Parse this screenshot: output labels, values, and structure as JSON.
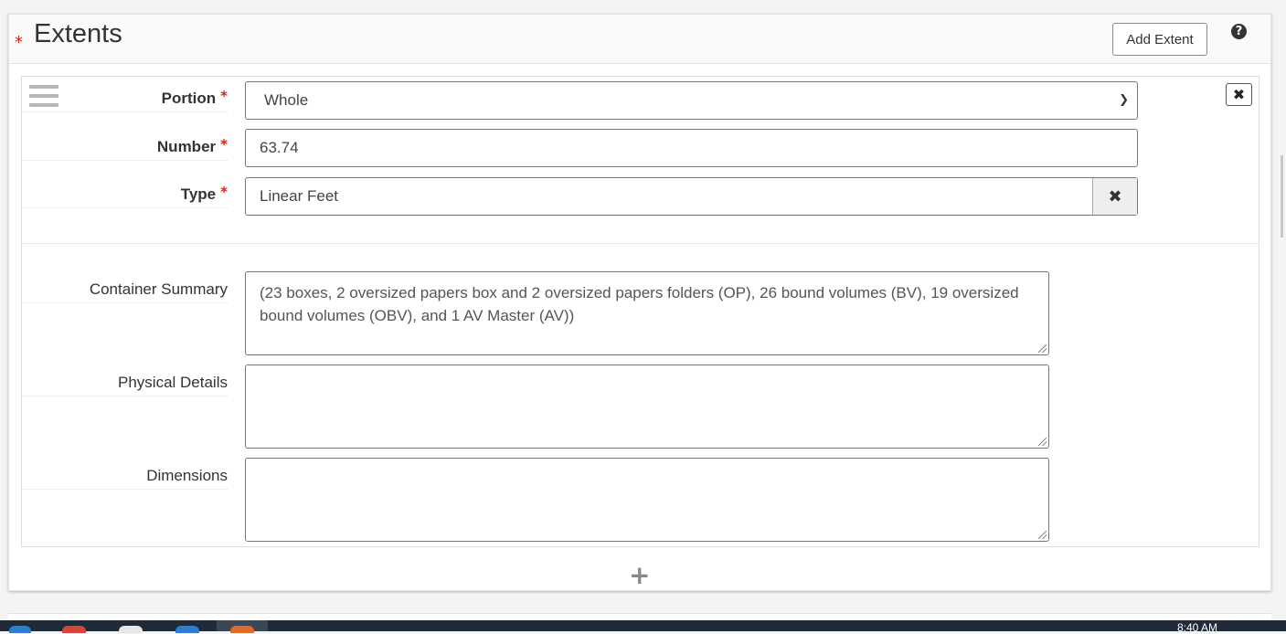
{
  "section": {
    "title": "Extents",
    "add_button_label": "Add Extent",
    "help_glyph": "?",
    "required_marker": "*"
  },
  "extent": {
    "portion": {
      "label": "Portion",
      "value": "Whole",
      "options": [
        "Whole"
      ]
    },
    "number": {
      "label": "Number",
      "value": "63.74"
    },
    "type": {
      "label": "Type",
      "value": "Linear Feet"
    },
    "container_summary": {
      "label": "Container Summary",
      "value": "(23 boxes, 2 oversized papers box and 2 oversized papers folders (OP), 26 bound volumes (BV), 19 oversized bound volumes (OBV), and 1 AV Master (AV))"
    },
    "physical_details": {
      "label": "Physical Details",
      "value": ""
    },
    "dimensions": {
      "label": "Dimensions",
      "value": ""
    }
  },
  "icons": {
    "drag": "drag-handle-icon",
    "remove": "close-icon",
    "clear": "close-icon",
    "add": "plus-icon",
    "help": "question-circle-icon"
  },
  "taskbar": {
    "clock": "8:40 AM"
  },
  "colors": {
    "required": "#d9221a",
    "taskbar": "#1f2b38"
  }
}
